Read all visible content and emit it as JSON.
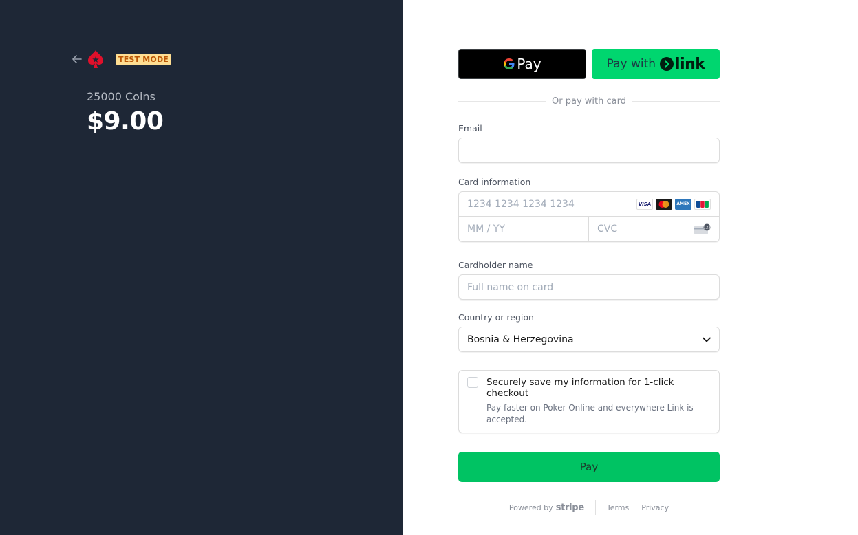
{
  "header": {
    "badge": "TEST MODE"
  },
  "product": {
    "name": "25000 Coins",
    "price": "$9.00"
  },
  "wallet": {
    "gpay_label": "Pay",
    "link_prefix": "Pay with",
    "link_word": "link"
  },
  "divider": "Or pay with card",
  "email": {
    "label": "Email",
    "placeholder": ""
  },
  "card": {
    "label": "Card information",
    "number_placeholder": "1234 1234 1234 1234",
    "expiry_placeholder": "MM / YY",
    "cvc_placeholder": "CVC",
    "brands": [
      "VISA",
      "mastercard",
      "AMEX",
      "JCB"
    ]
  },
  "cardholder": {
    "label": "Cardholder name",
    "placeholder": "Full name on card"
  },
  "country": {
    "label": "Country or region",
    "selected": "Bosnia & Herzegovina"
  },
  "save": {
    "title": "Securely save my information for 1-click checkout",
    "description": "Pay faster on Poker Online and everywhere Link is accepted."
  },
  "pay_button": "Pay",
  "footer": {
    "powered_by": "Powered by",
    "stripe": "stripe",
    "terms": "Terms",
    "privacy": "Privacy"
  },
  "colors": {
    "left_bg": "#1e2736",
    "link_green": "#00d66f",
    "pay_green": "#00c363",
    "badge_bg": "#ffde92",
    "badge_text": "#bb5504",
    "logo_red": "#e0102b"
  },
  "icons": [
    "back-arrow-icon",
    "pokerstars-logo-icon",
    "google-g-icon",
    "link-arrow-icon",
    "visa-icon",
    "mastercard-icon",
    "amex-icon",
    "jcb-icon",
    "cvc-card-icon",
    "chevron-down-icon"
  ]
}
